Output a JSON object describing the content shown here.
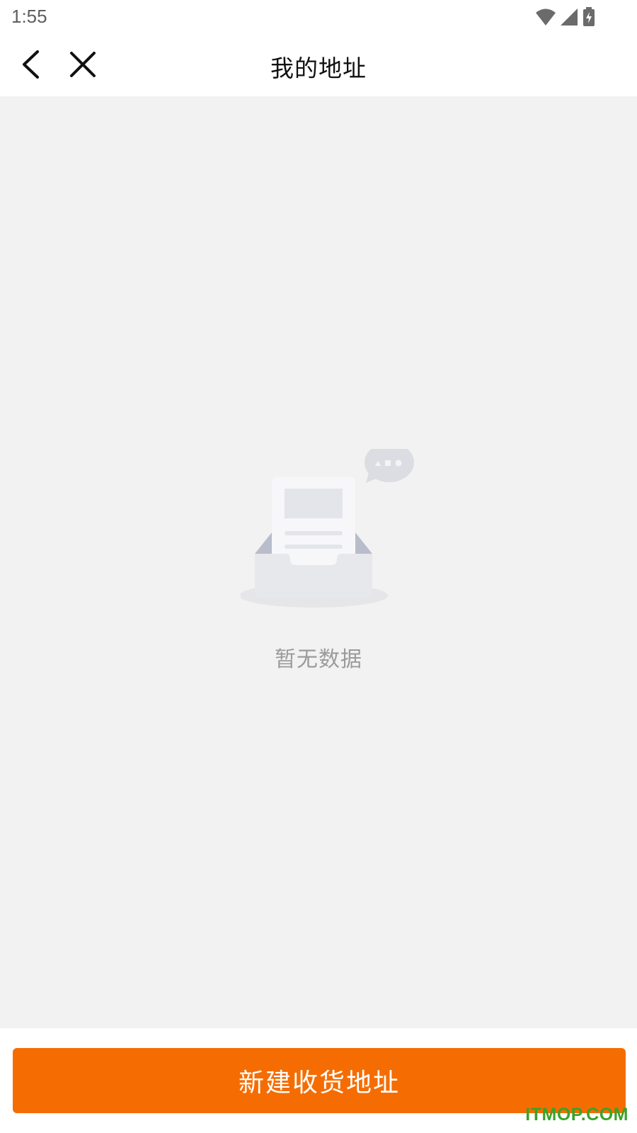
{
  "status_bar": {
    "time": "1:55",
    "icons": [
      "wifi-icon",
      "signal-icon",
      "battery-charging-icon"
    ]
  },
  "header": {
    "title": "我的地址",
    "back_icon": "chevron-left-icon",
    "close_icon": "close-icon"
  },
  "empty_state": {
    "illustration": "empty-inbox-icon",
    "message": "暂无数据"
  },
  "footer": {
    "new_address_label": "新建收货地址"
  },
  "watermark": {
    "text": "ITMOP.COM"
  },
  "colors": {
    "accent": "#f56d02",
    "content_background": "#f2f2f2",
    "watermark": "#3aa32a"
  }
}
